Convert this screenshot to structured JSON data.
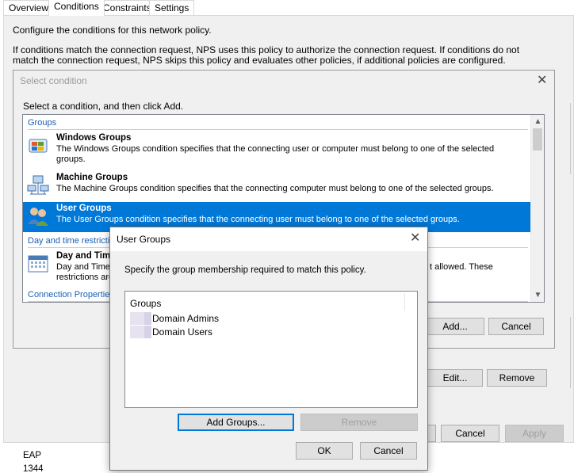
{
  "tabs": [
    "Overview",
    "Conditions",
    "Constraints",
    "Settings"
  ],
  "panel": {
    "intro": "Configure the conditions for this network policy.",
    "explain": "If conditions match the connection request, NPS uses this policy to authorize the connection request. If conditions do not match the connection request, NPS skips this policy and evaluates other policies, if additional policies are configured.",
    "edit_label": "Edit...",
    "remove_label": "Remove",
    "cancel_label": "Cancel",
    "apply_label": "Apply"
  },
  "bg_list": [
    "EAP",
    "1344"
  ],
  "select_condition": {
    "title": "Select condition",
    "instruction": "Select a condition, and then click Add.",
    "groups_header": "Groups",
    "items": [
      {
        "name": "Windows Groups",
        "desc": "The Windows Groups condition specifies that the connecting user or computer must belong to one of the selected groups."
      },
      {
        "name": "Machine Groups",
        "desc": "The Machine Groups condition specifies that the connecting computer must belong to one of the selected groups."
      },
      {
        "name": "User Groups",
        "desc": "The User Groups condition specifies that the connecting user must belong to one of the selected groups."
      }
    ],
    "daytime_header": "Day and time restrictio",
    "daytime_item": {
      "name": "Day and Tim",
      "desc_left": "Day and Time",
      "desc_left2": "restrictions are",
      "desc_right": "t allowed.  These"
    },
    "connprops_header": "Connection Properties",
    "add_label": "Add...",
    "cancel_label": "Cancel"
  },
  "user_groups": {
    "title": "User Groups",
    "instruction": "Specify the group membership required to match this policy.",
    "column": "Groups",
    "groups": [
      "Domain Admins",
      "Domain Users"
    ],
    "add_groups_label": "Add Groups...",
    "remove_label": "Remove",
    "ok_label": "OK",
    "cancel_label": "Cancel"
  },
  "colors": {
    "accent": "#0078d7",
    "group_header": "#1a5fb4"
  },
  "icons": [
    "windows-groups-icon",
    "machine-groups-icon",
    "user-groups-icon",
    "calendar-icon",
    "close-icon",
    "scroll-up-icon",
    "scroll-down-icon"
  ]
}
